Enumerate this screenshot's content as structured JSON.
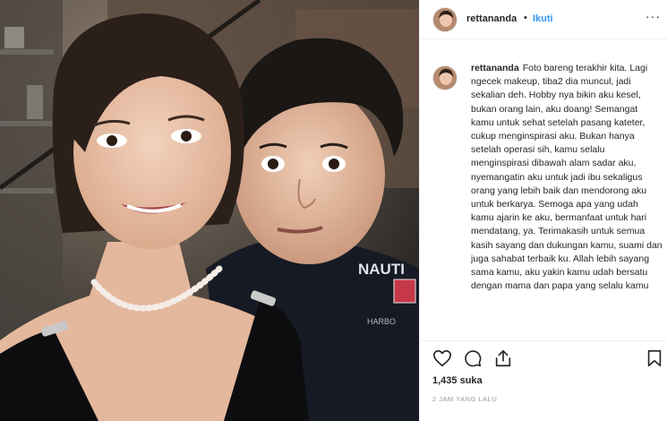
{
  "post": {
    "username": "rettananda",
    "follow_label": "Ikuti",
    "dot": "•",
    "more_label": "···"
  },
  "caption": {
    "username": "rettananda",
    "text": "Foto bareng terakhir kita. Lagi ngecek makeup, tiba2 dia muncul, jadi sekalian deh. Hobby nya bikin aku kesel, bukan orang lain, aku doang! Semangat kamu untuk sehat setelah pasang kateter, cukup menginspirasi aku. Bukan hanya setelah operasi sih, kamu selalu menginspirasi dibawah alam sadar aku, nyemangatin aku untuk jadi ibu sekaligus orang yang lebih baik dan mendorong aku untuk berkarya. Semoga apa yang udah kamu ajarin ke aku, bermanfaat untuk hari mendatang, ya. Terimakasih untuk semua kasih sayang dan dukungan kamu, suami dan juga sahabat terbaik ku. Allah lebih sayang sama kamu, aku yakin kamu udah bersatu dengan mama dan papa yang selalu kamu"
  },
  "photo": {
    "shirt_text": "NAUTI",
    "shirt_small_text": "HARBO"
  },
  "actions": {
    "icons": [
      "heart-icon",
      "comment-icon",
      "share-icon",
      "bookmark-icon"
    ]
  },
  "stats": {
    "likes": "1,435 suka",
    "timestamp": "2 JAM YANG LALU"
  },
  "colors": {
    "follow": "#3897f0",
    "text": "#262626",
    "muted": "#999999",
    "border": "#efefef"
  }
}
